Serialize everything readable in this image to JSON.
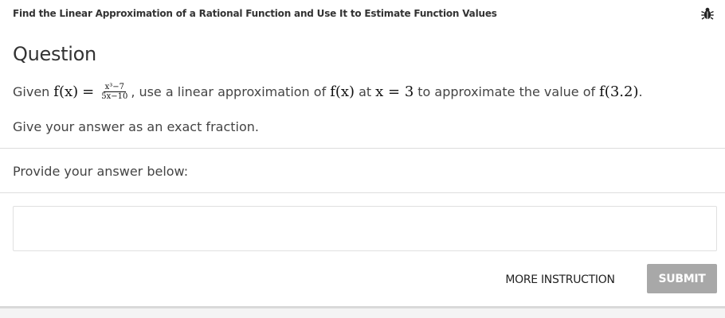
{
  "header": {
    "topic_title": "Find the Linear Approximation of a Rational Function and Use It to Estimate Function Values",
    "bug_icon": "bug-icon"
  },
  "question": {
    "heading": "Question",
    "given_text": "Given",
    "func_lhs": "f(x)",
    "equals": "=",
    "numerator": "x³−7",
    "denominator": "5x−10",
    "comma": ",",
    "middle_text": "use a linear approximation of",
    "func_ref": "f(x)",
    "at_text": "at",
    "point_eq": "x = 3",
    "to_text": "to approximate the value of",
    "target": "f(3.2)",
    "period": ".",
    "instruction": "Give your answer as an exact fraction."
  },
  "answer": {
    "label": "Provide your answer below:",
    "value": ""
  },
  "actions": {
    "more_instruction": "MORE INSTRUCTION",
    "submit": "SUBMIT"
  },
  "colors": {
    "submit_bg": "#a8a8a8",
    "divider": "#dddddd",
    "text": "#333333"
  }
}
